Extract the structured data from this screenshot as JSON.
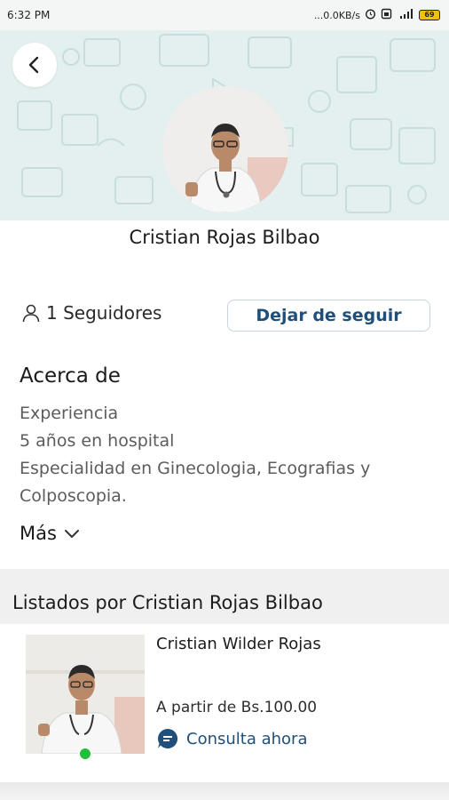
{
  "status_bar": {
    "time": "6:32 PM",
    "network": "...0.0KB/s",
    "battery": "69"
  },
  "header": {
    "back_icon": "chevron-left-icon"
  },
  "profile": {
    "name": "Cristian Rojas Bilbao",
    "followers_label": "1 Seguidores",
    "unfollow_label": "Dejar de seguir"
  },
  "about": {
    "title": "Acerca de",
    "lines": [
      "Experiencia",
      "5 años en hospital",
      "Especialidad en Ginecologia, Ecografias y",
      "Colposcopia."
    ],
    "more_label": "Más"
  },
  "listings": {
    "title": "Listados por Cristian Rojas Bilbao",
    "items": [
      {
        "name": "Cristian Wilder Rojas",
        "price": "A partir de Bs.100.00",
        "action_label": "Consulta ahora"
      }
    ]
  },
  "colors": {
    "accent": "#1f4f7a",
    "header_bg": "#e3f0ef",
    "online": "#1fbf3a"
  }
}
